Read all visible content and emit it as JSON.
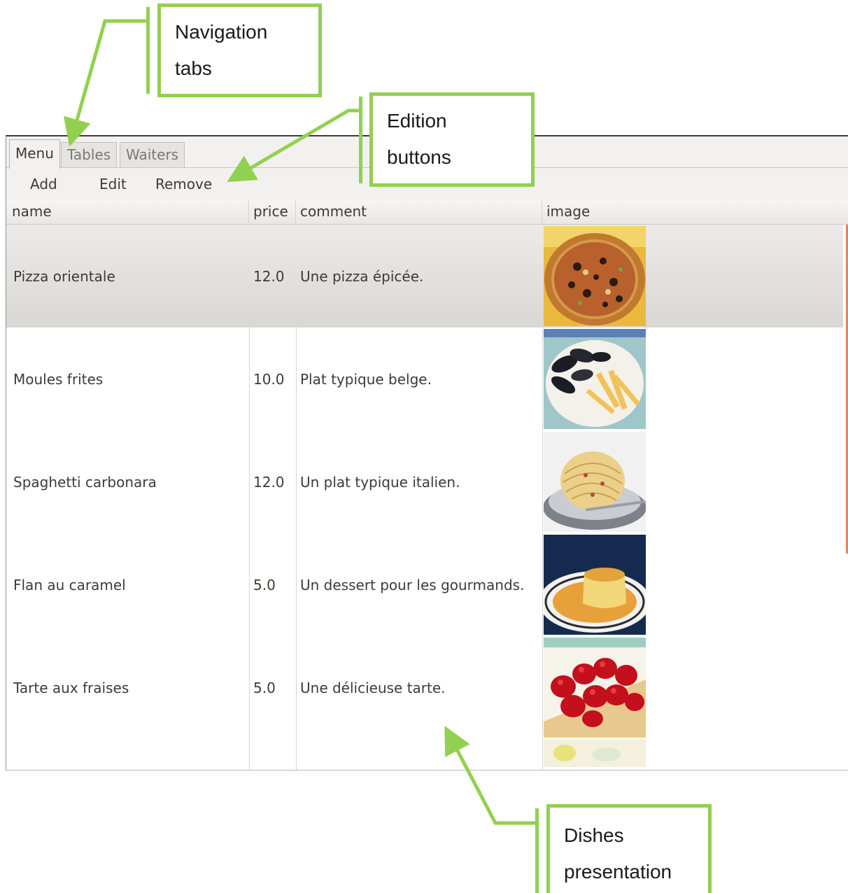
{
  "tabs": [
    {
      "label": "Menu",
      "active": true
    },
    {
      "label": "Tables",
      "active": false
    },
    {
      "label": "Waiters",
      "active": false
    }
  ],
  "toolbar": {
    "add_label": "Add",
    "edit_label": "Edit",
    "remove_label": "Remove"
  },
  "table": {
    "columns": [
      "name",
      "price",
      "comment",
      "image"
    ],
    "rows": [
      {
        "name": "Pizza orientale",
        "price": "12.0",
        "comment": "Une pizza épicée.",
        "image_icon": "pizza-image",
        "selected": true
      },
      {
        "name": "Moules frites",
        "price": "10.0",
        "comment": "Plat typique belge.",
        "image_icon": "mussels-fries-image",
        "selected": false
      },
      {
        "name": "Spaghetti carbonara",
        "price": "12.0",
        "comment": "Un plat typique italien.",
        "image_icon": "spaghetti-image",
        "selected": false
      },
      {
        "name": "Flan au caramel",
        "price": "5.0",
        "comment": "Un dessert pour les gourmands.",
        "image_icon": "flan-image",
        "selected": false
      },
      {
        "name": "Tarte aux fraises",
        "price": "5.0",
        "comment": "Une délicieuse tarte.",
        "image_icon": "strawberry-tart-image",
        "selected": false
      }
    ]
  },
  "annotations": {
    "navigation": [
      "Navigation",
      "tabs"
    ],
    "edition": [
      "Edition",
      "buttons"
    ],
    "dishes": [
      "Dishes",
      "presentation"
    ],
    "color": "#92d050"
  }
}
